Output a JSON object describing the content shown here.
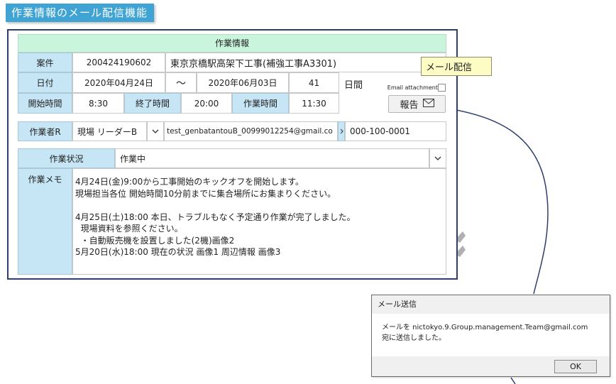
{
  "banner": {
    "title": "作業情報のメール配信機能"
  },
  "work_info": {
    "section_header": "作業情報",
    "case_label": "案件",
    "case_number": "200424190602",
    "case_name": "東京京橋駅高架下工事(補強工事A3301)",
    "date_label": "日付",
    "start_date": "2020年04月24日",
    "tilde": "〜",
    "end_date": "2020年06月03日",
    "days": "41",
    "days_unit": "日間",
    "start_time_label": "開始時間",
    "start_time": "8:30",
    "end_time_label": "終了時間",
    "end_time": "20:00",
    "work_hours_label": "作業時間",
    "work_hours": "11:30"
  },
  "email": {
    "attachment_label": "Email attachment",
    "report_button": "報告",
    "callout": "メール配信"
  },
  "worker": {
    "label": "作業者R",
    "name": "現場 リーダーB",
    "email": "test_genbatantouB_00999012254@gmail.co",
    "phone": "000-100-0001"
  },
  "status": {
    "label": "作業状況",
    "value": "作業中"
  },
  "memo": {
    "label": "作業メモ",
    "lines": [
      "4月24日(金)9:00から工事開始のキックオフを開始します。",
      "現場担当各位 開始時間10分前までに集合場所にお集まりください。",
      "",
      "4月25日(土)18:00 本日、トラブルもなく予定通り作業が完了しました。",
      "  現場資料を参照ください。",
      "  ・自動販売機を設置しました(2機)画像2",
      "5月20日(水)18:00 現在の状況 画像1 周辺情報 画像3"
    ]
  },
  "dialog": {
    "title": "メール送信",
    "message_line1": "メールを nictokyo.9.Group.management.Team@gmail.com",
    "message_line2": "宛に送信しました。",
    "ok_button": "OK"
  }
}
